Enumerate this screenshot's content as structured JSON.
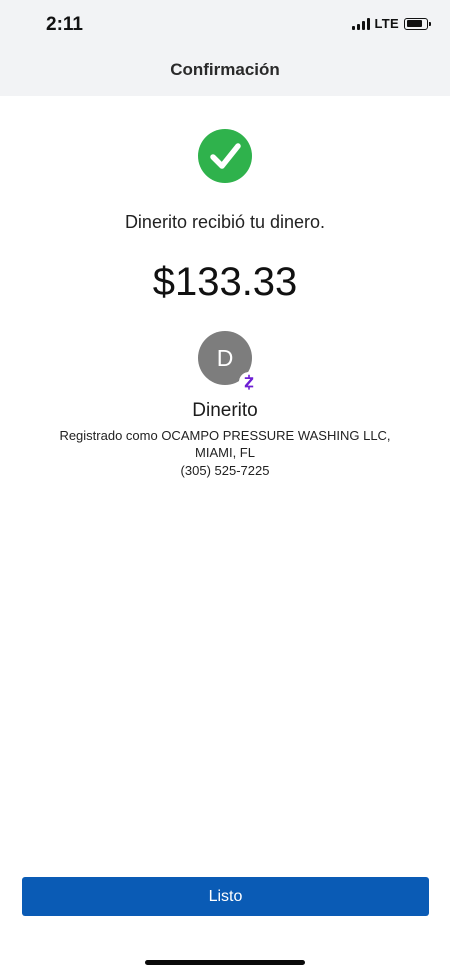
{
  "status_bar": {
    "time": "2:11",
    "network": "LTE"
  },
  "header": {
    "title": "Confirmación"
  },
  "confirmation": {
    "status_icon": "checkmark-icon",
    "message": "Dinerito recibió tu dinero.",
    "amount": "$133.33"
  },
  "recipient": {
    "avatar_initial": "D",
    "badge_icon": "zelle-icon",
    "name": "Dinerito",
    "registered_as": "Registrado como OCAMPO PRESSURE WASHING LLC,",
    "location": "MIAMI, FL",
    "phone": "(305) 525-7225"
  },
  "actions": {
    "done_label": "Listo"
  },
  "colors": {
    "primary": "#0a5bb5",
    "success": "#2fb24c",
    "zelle": "#6d1ed4",
    "avatar": "#7d7d7d",
    "header_bg": "#f2f3f5"
  }
}
